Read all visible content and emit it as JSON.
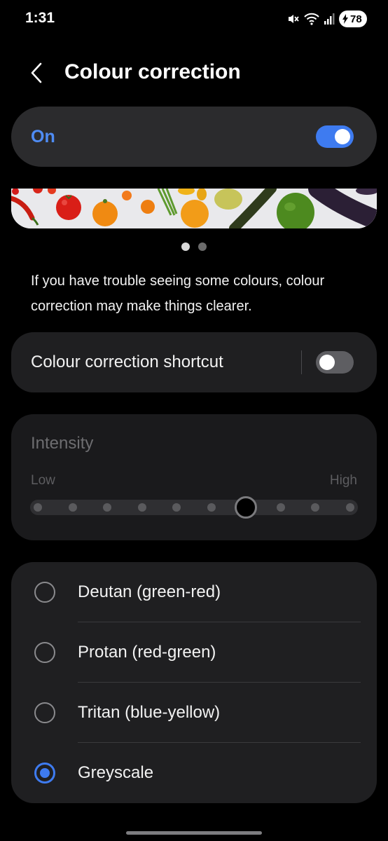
{
  "status_bar": {
    "time": "1:31",
    "battery_level": "78",
    "icons": [
      "mute-icon",
      "wifi-icon",
      "signal-icon",
      "battery-charging-icon"
    ]
  },
  "header": {
    "title": "Colour correction",
    "back_icon": "chevron-left-icon"
  },
  "master_toggle": {
    "label": "On",
    "enabled": true
  },
  "preview": {
    "page_count": 2,
    "active_page": 1
  },
  "description": "If you have trouble seeing some colours, colour correction may make things clearer.",
  "shortcut": {
    "label": "Colour correction shortcut",
    "enabled": false
  },
  "intensity": {
    "title": "Intensity",
    "low_label": "Low",
    "high_label": "High",
    "steps": 10,
    "value": 7,
    "disabled": true
  },
  "options": [
    {
      "label": "Deutan (green-red)",
      "selected": false
    },
    {
      "label": "Protan (red-green)",
      "selected": false
    },
    {
      "label": "Tritan (blue-yellow)",
      "selected": false
    },
    {
      "label": "Greyscale",
      "selected": true
    }
  ],
  "colors": {
    "accent": "#3e7bf0",
    "label_accent": "#4f8cf4",
    "card_bg": "#1f1f21",
    "master_card_bg": "#2b2b2d"
  }
}
